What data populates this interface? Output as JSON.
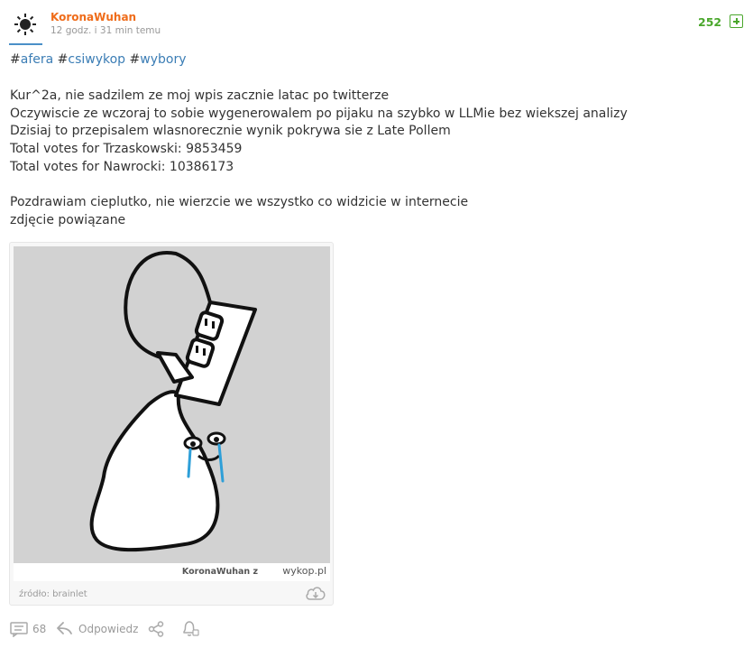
{
  "post": {
    "author": "KoronaWuhan",
    "time": "12 godz. i 31 min temu",
    "votes": "252",
    "tags": [
      {
        "hash": "#",
        "name": "afera"
      },
      {
        "hash": "#",
        "name": "csiwykop"
      },
      {
        "hash": "#",
        "name": "wybory"
      }
    ],
    "lines": [
      "Kur^2a, nie sadzilem ze moj wpis zacznie latac po twitterze",
      "Oczywiscie ze wczoraj to sobie wygenerowalem po pijaku na szybko w LLMie bez wiekszej analizy",
      "Dzisiaj to przepisalem wlasnorecznie wynik pokrywa sie z Late Pollem",
      "Total votes for Trzaskowski: 9853459",
      "Total votes for Nawrocki: 10386173",
      "Pozdrawiam cieplutko, nie wierzcie we wszystko co widzicie w internecie",
      "zdjęcie powiązane"
    ],
    "image": {
      "watermark_text": "KoronaWuhan  z",
      "watermark_site": "wykop.pl",
      "source": "źródło: brainlet"
    },
    "comments_count": "68",
    "reply_label": "Odpowiedz"
  },
  "colors": {
    "author": "#ef6c1a",
    "tag": "#3b7db5",
    "vote": "#4aa72c",
    "tear": "#2e9fd8"
  },
  "icons": [
    "sun-avatar-icon",
    "plus-icon",
    "cloud-download-icon",
    "comments-icon",
    "reply-icon",
    "share-icon",
    "bell-icon"
  ]
}
